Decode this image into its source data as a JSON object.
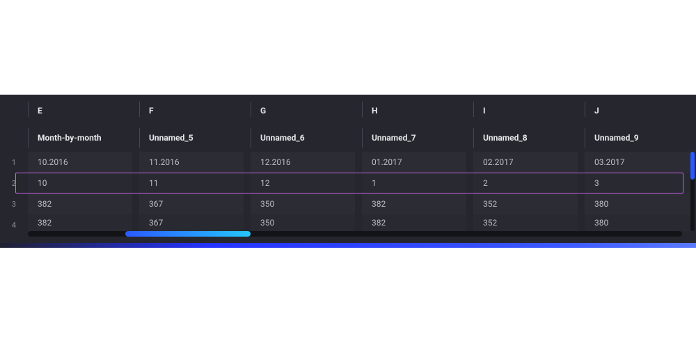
{
  "grid": {
    "column_letters": [
      "E",
      "F",
      "G",
      "H",
      "I",
      "J"
    ],
    "column_names": [
      "Month-by-month",
      "Unnamed_5",
      "Unnamed_6",
      "Unnamed_7",
      "Unnamed_8",
      "Unnamed_9"
    ],
    "row_indices": [
      "1",
      "2",
      "3",
      "4"
    ],
    "rows": [
      [
        "10.2016",
        "11.2016",
        "12.2016",
        "01.2017",
        "02.2017",
        "03.2017"
      ],
      [
        "10",
        "11",
        "12",
        "1",
        "2",
        "3"
      ],
      [
        "382",
        "367",
        "350",
        "382",
        "352",
        "380"
      ],
      [
        "382",
        "367",
        "350",
        "382",
        "352",
        "380"
      ]
    ],
    "selected_row_index": 1
  },
  "colors": {
    "panel_bg": "#26262e",
    "selection_border": "#c765e6",
    "scroll_thumb_start": "#2b59ff",
    "scroll_thumb_end": "#24c6ff"
  }
}
